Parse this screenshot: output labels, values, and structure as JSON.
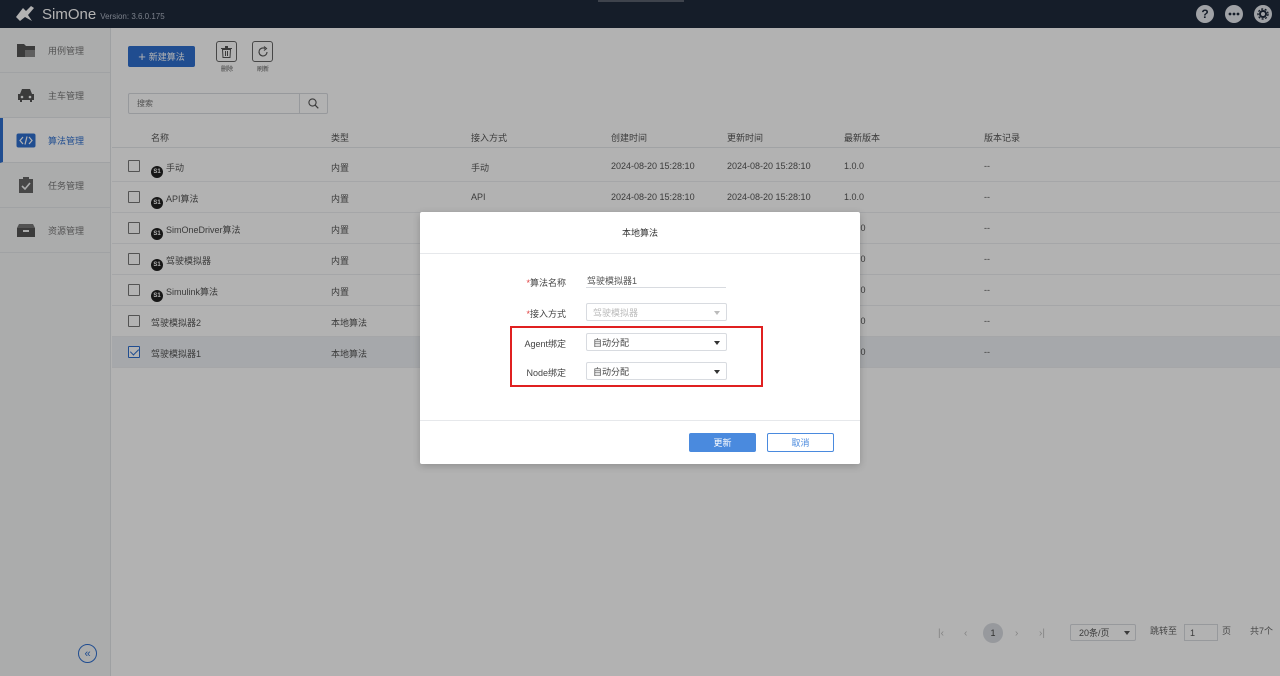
{
  "app": {
    "name": "SimOne",
    "version": "Version: 3.6.0.175"
  },
  "topbar_icons": [
    "help-icon",
    "more-icon",
    "settings-icon"
  ],
  "sidebar": {
    "items": [
      {
        "label": "用例管理",
        "icon": "folder-icon",
        "active": false
      },
      {
        "label": "主车管理",
        "icon": "car-icon",
        "active": false
      },
      {
        "label": "算法管理",
        "icon": "code-icon",
        "active": true
      },
      {
        "label": "任务管理",
        "icon": "task-check-icon",
        "active": false
      },
      {
        "label": "资源管理",
        "icon": "box-icon",
        "active": false
      }
    ],
    "collapse_icon": "double-chevron-left-icon"
  },
  "toolbar": {
    "new_label": "新建算法",
    "delete_label": "删除",
    "refresh_label": "刷新"
  },
  "search": {
    "placeholder": "搜索"
  },
  "table": {
    "columns": [
      "名称",
      "类型",
      "接入方式",
      "创建时间",
      "更新时间",
      "最新版本",
      "版本记录"
    ],
    "rows": [
      {
        "name": "手动",
        "badge": true,
        "type": "内置",
        "access": "手动",
        "created": "2024-08-20 15:28:10",
        "updated": "2024-08-20 15:28:10",
        "version": "1.0.0",
        "history": "--",
        "checked": false
      },
      {
        "name": "API算法",
        "badge": true,
        "type": "内置",
        "access": "API",
        "created": "2024-08-20 15:28:10",
        "updated": "2024-08-20 15:28:10",
        "version": "1.0.0",
        "history": "--",
        "checked": false
      },
      {
        "name": "SimOneDriver算法",
        "badge": true,
        "type": "内置",
        "access": "",
        "created": "",
        "updated": "",
        "version": ".0",
        "history": "--",
        "checked": false
      },
      {
        "name": "驾驶模拟器",
        "badge": true,
        "type": "内置",
        "access": "",
        "created": "",
        "updated": "",
        "version": ".0",
        "history": "--",
        "checked": false
      },
      {
        "name": "Simulink算法",
        "badge": true,
        "type": "内置",
        "access": "",
        "created": "",
        "updated": "",
        "version": ".0",
        "history": "--",
        "checked": false
      },
      {
        "name": "驾驶模拟器2",
        "badge": false,
        "type": "本地算法",
        "access": "",
        "created": "",
        "updated": "",
        "version": ".0",
        "history": "--",
        "checked": false
      },
      {
        "name": "驾驶模拟器1",
        "badge": false,
        "type": "本地算法",
        "access": "",
        "created": "",
        "updated": "",
        "version": ".0",
        "history": "--",
        "checked": true
      }
    ]
  },
  "pagination": {
    "current_page": "1",
    "page_size": "20条/页",
    "goto_label": "跳转至",
    "goto_value": "1",
    "page_unit": "页",
    "total": "共7个"
  },
  "dialog": {
    "title": "本地算法",
    "fields": {
      "name_label": "算法名称",
      "name_value": "驾驶模拟器1",
      "access_label": "接入方式",
      "access_value": "驾驶模拟器",
      "agent_label": "Agent绑定",
      "agent_value": "自动分配",
      "node_label": "Node绑定",
      "node_value": "自动分配"
    },
    "required_mark": "*",
    "submit_label": "更新",
    "cancel_label": "取消",
    "highlight_color": "#e02020"
  },
  "colors": {
    "topbar": "#1f2a3c",
    "accent": "#2f6fcf",
    "primary_button": "#4a8ade"
  }
}
